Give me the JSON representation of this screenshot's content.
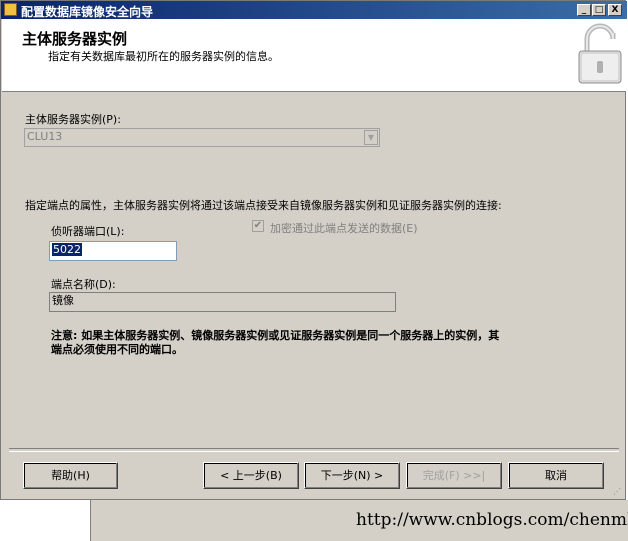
{
  "window": {
    "title": "配置数据库镜像安全向导",
    "minimize": "_",
    "maximize": "□",
    "close": "X"
  },
  "header": {
    "title": "主体服务器实例",
    "subtitle": "指定有关数据库最初所在的服务器实例的信息。",
    "icon": "lock-icon"
  },
  "form": {
    "instance_label": "主体服务器实例(P):",
    "instance_value": "CLU13",
    "endpoint_props_label": "指定端点的属性，主体服务器实例将通过该端点接受来自镜像服务器实例和见证服务器实例的连接:",
    "port_label": "侦听器端口(L):",
    "port_value": "5022",
    "encrypt_label": "加密通过此端点发送的数据(E)",
    "encrypt_checked": true,
    "endpoint_name_label": "端点名称(D):",
    "endpoint_name_value": "镜像",
    "note_line1": "注意: 如果主体服务器实例、镜像服务器实例或见证服务器实例是同一个服务器上的实例，其",
    "note_line2": "端点必须使用不同的端口。"
  },
  "buttons": {
    "help": "帮助(H)",
    "back": "< 上一步(B)",
    "next": "下一步(N) >",
    "finish": "完成(F) >>|",
    "cancel": "取消"
  },
  "watermark": "http://www.cnblogs.com/chenmh/"
}
